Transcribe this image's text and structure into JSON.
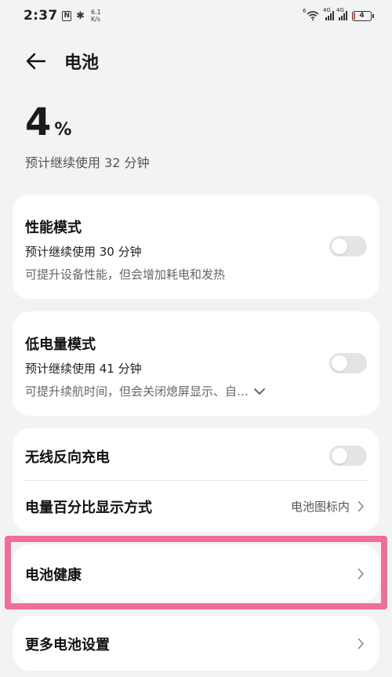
{
  "status_bar": {
    "time": "2:37",
    "nfc_glyph": "N",
    "bluetooth_glyph": "✱",
    "net_speed_value": "6.1",
    "net_speed_unit": "K/s",
    "wifi_label": "6",
    "sim1_label": "4G",
    "sim2_label": "4G",
    "battery_level": "4",
    "battery_low_color": "#e53935"
  },
  "header": {
    "back_icon": "arrow-left-icon",
    "title": "电池"
  },
  "battery": {
    "level": "4",
    "unit": "%",
    "remaining": "预计继续使用 32 分钟"
  },
  "performance_mode": {
    "title": "性能模式",
    "remaining": "预计继续使用 30 分钟",
    "description": "可提升设备性能，但会增加耗电和发热",
    "enabled": false
  },
  "power_saving_mode": {
    "title": "低电量模式",
    "remaining": "预计继续使用 41 分钟",
    "description": "可提升续航时间，但会关闭熄屏显示、自…",
    "enabled": false,
    "expand_icon": "chevron-down-icon"
  },
  "reverse_charging": {
    "title": "无线反向充电",
    "enabled": false
  },
  "percentage_display": {
    "title": "电量百分比显示方式",
    "value": "电池图标内"
  },
  "battery_health": {
    "title": "电池健康"
  },
  "more_settings": {
    "title": "更多电池设置"
  },
  "highlight_color": "#ef6f96"
}
